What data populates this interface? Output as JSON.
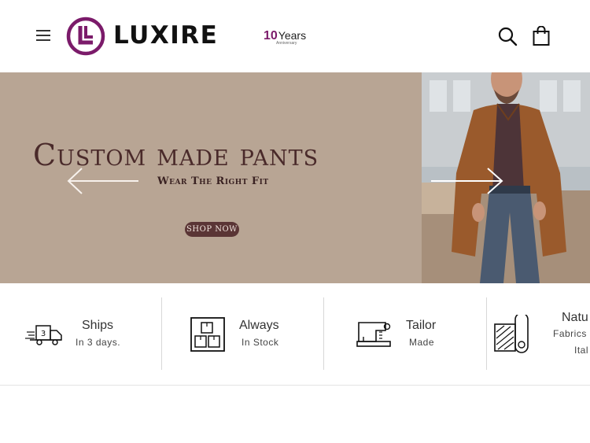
{
  "header": {
    "brand": "LUXIRE",
    "anniversary_number": "10",
    "anniversary_word": "Years",
    "anniversary_small": "Anniversary"
  },
  "hero": {
    "title": "Custom made pants",
    "subtitle": "Wear The Right Fit",
    "cta_label": "SHOP NOW"
  },
  "features": [
    {
      "title": "Ships",
      "subtitle": "In 3 days.",
      "icon": "truck-icon",
      "badge": "3"
    },
    {
      "title": "Always",
      "subtitle": "In Stock",
      "icon": "boxes-icon"
    },
    {
      "title": "Tailor",
      "subtitle": "Made",
      "icon": "sewing-machine-icon"
    },
    {
      "title": "Natu",
      "subtitle": "Fabrics",
      "subtitle2": "Ital",
      "icon": "fabric-roll-icon"
    }
  ],
  "colors": {
    "hero_bg": "#b8a594",
    "brand_purple": "#7b1b6a",
    "title_color": "#4a2a2a",
    "cta_bg": "#5a3535"
  }
}
